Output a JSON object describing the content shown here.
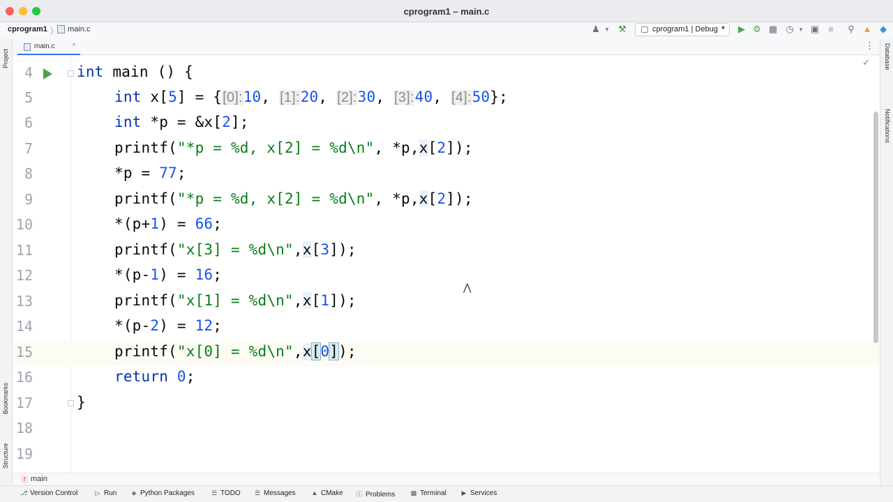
{
  "window": {
    "title": "cprogram1 – main.c"
  },
  "breadcrumb": {
    "project": "cprogram1",
    "separator": "〉",
    "file": "main.c"
  },
  "toolbar": {
    "run_config": "cprogram1 | Debug"
  },
  "left_panels": {
    "top": "Project",
    "middle": "Bookmarks",
    "bottom": "Structure"
  },
  "right_panels": {
    "top": "Database",
    "bottom": "Notifications"
  },
  "editor_tab": {
    "label": "main.c",
    "close": "×"
  },
  "code_lines": [
    {
      "no": "4"
    },
    {
      "no": "5"
    },
    {
      "no": "6"
    },
    {
      "no": "7"
    },
    {
      "no": "8"
    },
    {
      "no": "9"
    },
    {
      "no": "10"
    },
    {
      "no": "11"
    },
    {
      "no": "12"
    },
    {
      "no": "13"
    },
    {
      "no": "14"
    },
    {
      "no": "15"
    },
    {
      "no": "16"
    },
    {
      "no": "17"
    },
    {
      "no": "18"
    },
    {
      "no": "19"
    }
  ],
  "code": {
    "l4": {
      "kw": "int",
      "rest": " main () {"
    },
    "l5": {
      "kw": "int",
      "decl": " x[",
      "size": "5",
      "mid": "] = {",
      "h0": "[0]:",
      "v0": "10",
      "h1": "[1]:",
      "v1": "20",
      "h2": "[2]:",
      "v2": "30",
      "h3": "[3]:",
      "v3": "40",
      "h4": "[4]:",
      "v4": "50",
      "end": "};"
    },
    "l6": {
      "kw": "int",
      "a": " *p = &x[",
      "idx": "2",
      "b": "];"
    },
    "l7": {
      "a": "printf(",
      "s": "\"*p = %d, x[2] = %d\\n\"",
      "b": ", *p,",
      "x": "x",
      "c": "[",
      "idx": "2",
      "d": "]);"
    },
    "l8": {
      "a": "*p = ",
      "n": "77",
      "b": ";"
    },
    "l9": {
      "a": "printf(",
      "s": "\"*p = %d, x[2] = %d\\n\"",
      "b": ", *p,",
      "x": "x",
      "c": "[",
      "idx": "2",
      "d": "]);"
    },
    "l10": {
      "a": "*(p+",
      "one": "1",
      "b": ") = ",
      "n": "66",
      "c": ";"
    },
    "l11": {
      "a": "printf(",
      "s": "\"x[3] = %d\\n\"",
      "b": ",",
      "x": "x",
      "c": "[",
      "idx": "3",
      "d": "]);"
    },
    "l12": {
      "a": "*(p-",
      "one": "1",
      "b": ") = ",
      "n": "16",
      "c": ";"
    },
    "l13": {
      "a": "printf(",
      "s": "\"x[1] = %d\\n\"",
      "b": ",",
      "x": "x",
      "c": "[",
      "idx": "1",
      "d": "]);"
    },
    "l14": {
      "a": "*(p-",
      "two": "2",
      "b": ") = ",
      "n": "12",
      "c": ";"
    },
    "l15": {
      "a": "printf(",
      "s": "\"x[0] = %d\\n\"",
      "b": ",",
      "x": "x",
      "c": "[",
      "idx": "0",
      "d": "]",
      "e": ");"
    },
    "l16": {
      "kw": "return",
      "sp": " ",
      "n": "0",
      "b": ";"
    },
    "l17": {
      "brace": "}"
    }
  },
  "function_crumb": {
    "badge": "f",
    "name": "main"
  },
  "statusbar": {
    "items": [
      "Version Control",
      "Run",
      "Python Packages",
      "TODO",
      "Messages",
      "CMake",
      "Problems",
      "Terminal",
      "Services"
    ]
  },
  "colors": {
    "accent": "#3574f0",
    "keyword": "#0033b3",
    "number": "#1750eb",
    "string": "#067d17",
    "run_green": "#4ea24e"
  },
  "icons": [
    "hammer-icon",
    "run-icon",
    "debug-icon",
    "coverage-icon",
    "profiler-icon",
    "stop-icon",
    "search-icon",
    "update-icon",
    "plugin-icon",
    "user-icon",
    "check-icon"
  ]
}
